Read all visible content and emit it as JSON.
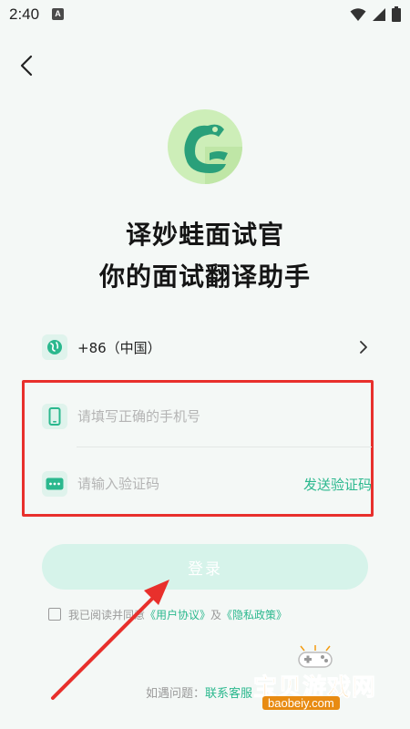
{
  "status_bar": {
    "time": "2:40",
    "app_icon_letter": "A"
  },
  "header": {
    "back_icon": "back-arrow-icon"
  },
  "brand": {
    "title_line1": "译妙蛙面试官",
    "title_line2": "你的面试翻译助手",
    "accent": "#2bb88e"
  },
  "country": {
    "code_label": "+86（中国）",
    "icon": "globe-icon"
  },
  "form": {
    "phone_placeholder": "请填写正确的手机号",
    "code_placeholder": "请输入验证码",
    "send_code_label": "发送验证码"
  },
  "login": {
    "label": "登录"
  },
  "agreement": {
    "prefix": "我已阅读并同意",
    "user_agreement": "《用户协议》",
    "and": "及",
    "privacy_policy": "《隐私政策》"
  },
  "help": {
    "prefix": "如遇问题：",
    "link": "联系客服"
  },
  "watermark": {
    "name": "宝贝游戏网",
    "url": "baobeiy.com"
  },
  "annotation": {
    "box_color": "#e8302c"
  }
}
